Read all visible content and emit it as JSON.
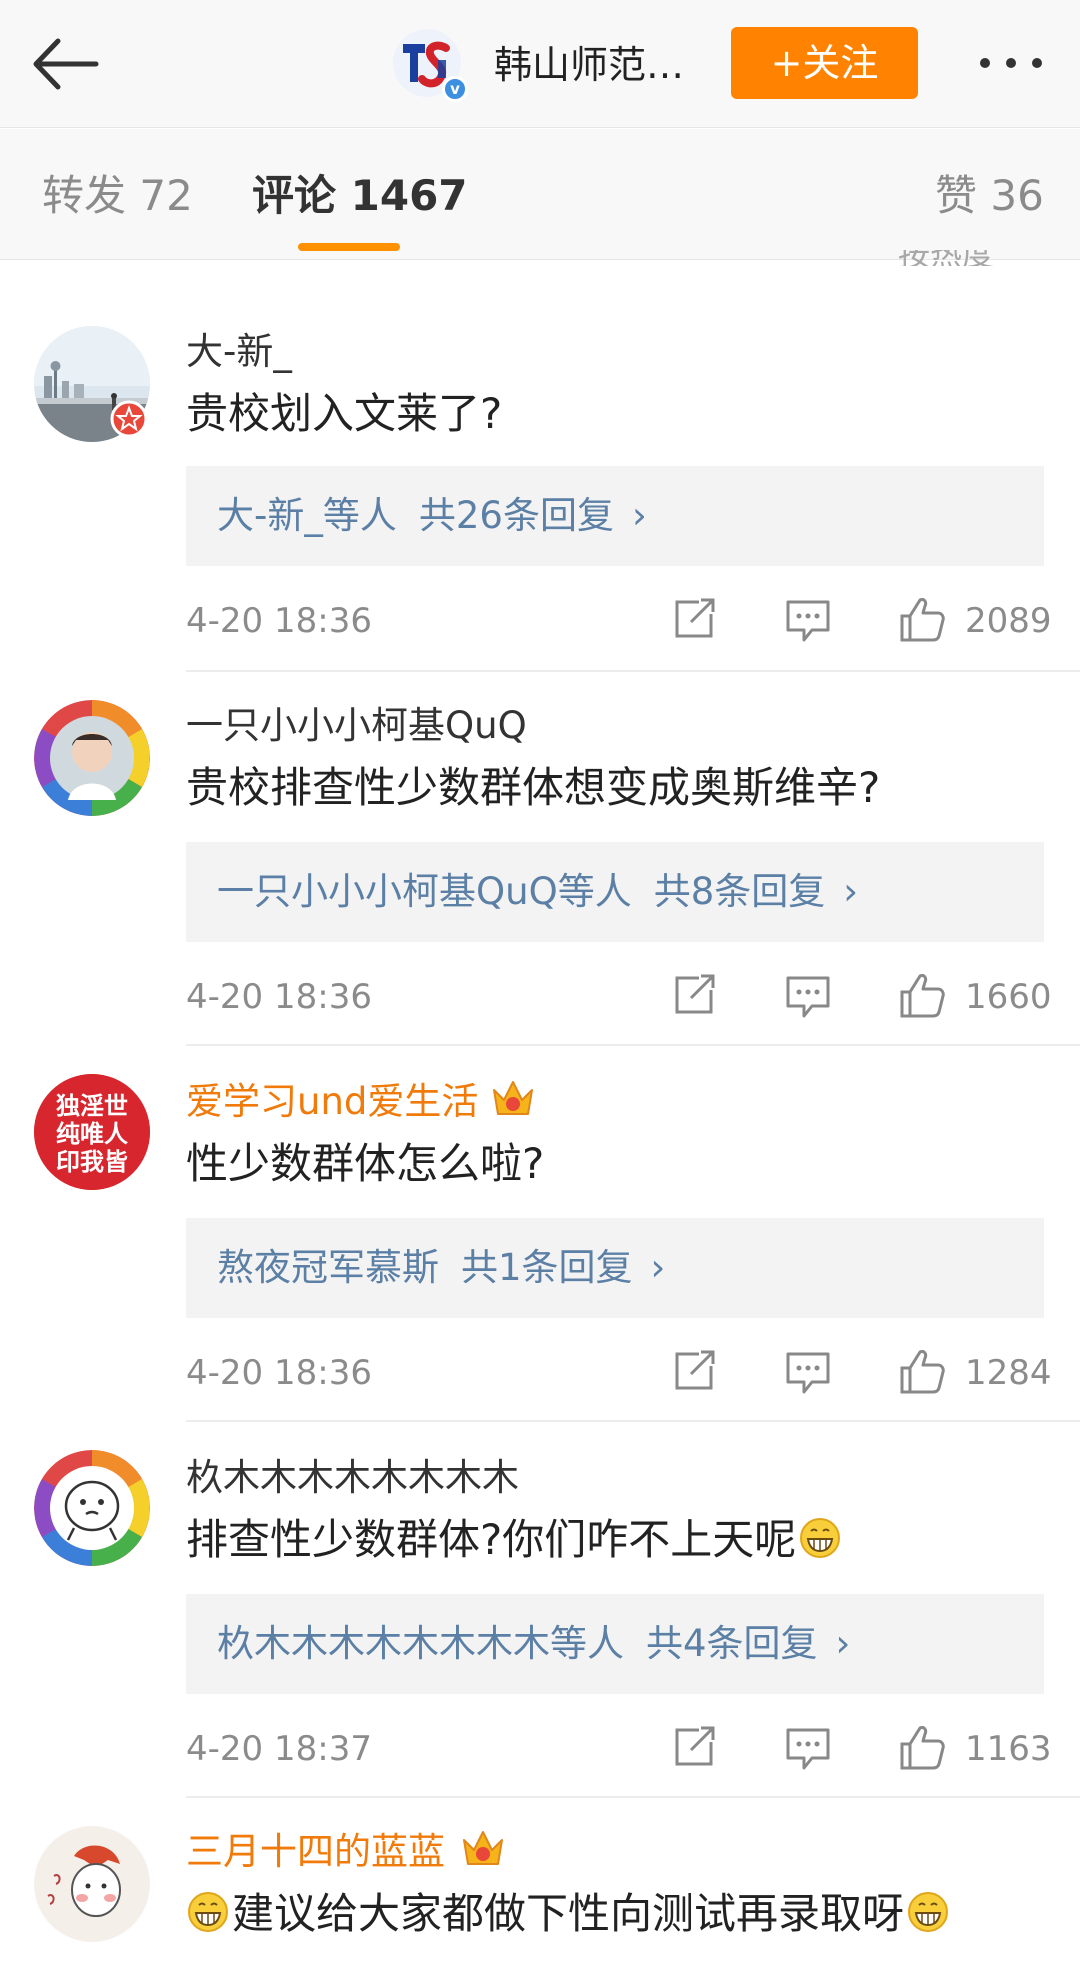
{
  "header": {
    "title": "韩山师范…",
    "follow_label": "+关注",
    "verified_mark": "v"
  },
  "tabs": {
    "repost": "转发 72",
    "comments": "评论 1467",
    "likes": "赞 36"
  },
  "sort_peek": "按热度",
  "comments": [
    {
      "user": "大-新_",
      "vip": false,
      "text": "贵校划入文莱了?",
      "reply_users": "大-新_等人",
      "reply_count": "共26条回复",
      "time": "4-20 18:36",
      "likes": "2089"
    },
    {
      "user": "一只小小小柯基QuQ",
      "vip": false,
      "text": "贵校排查性少数群体想变成奥斯维辛?",
      "reply_users": "一只小小小柯基QuQ等人",
      "reply_count": "共8条回复",
      "time": "4-20 18:36",
      "likes": "1660"
    },
    {
      "user": "爱学习und爱生活",
      "vip": true,
      "avatar_text": "独淫世纯唯人印我皆",
      "text": "性少数群体怎么啦?",
      "reply_users": "熬夜冠军慕斯",
      "reply_count": "共1条回复",
      "time": "4-20 18:36",
      "likes": "1284"
    },
    {
      "user": "杦木木木木木木木木",
      "vip": false,
      "text": "排查性少数群体?你们咋不上天呢",
      "reply_users": "杦木木木木木木木木等人",
      "reply_count": "共4条回复",
      "time": "4-20 18:37",
      "likes": "1163"
    },
    {
      "user": "三月十四的蓝蓝",
      "vip": true,
      "text": "建议给大家都做下性向测试再录取呀"
    }
  ],
  "colors": {
    "accent": "#ff8200",
    "tab_underline": "#ff9000",
    "link": "#5b7fa5",
    "vip_name": "#f07a0a"
  }
}
